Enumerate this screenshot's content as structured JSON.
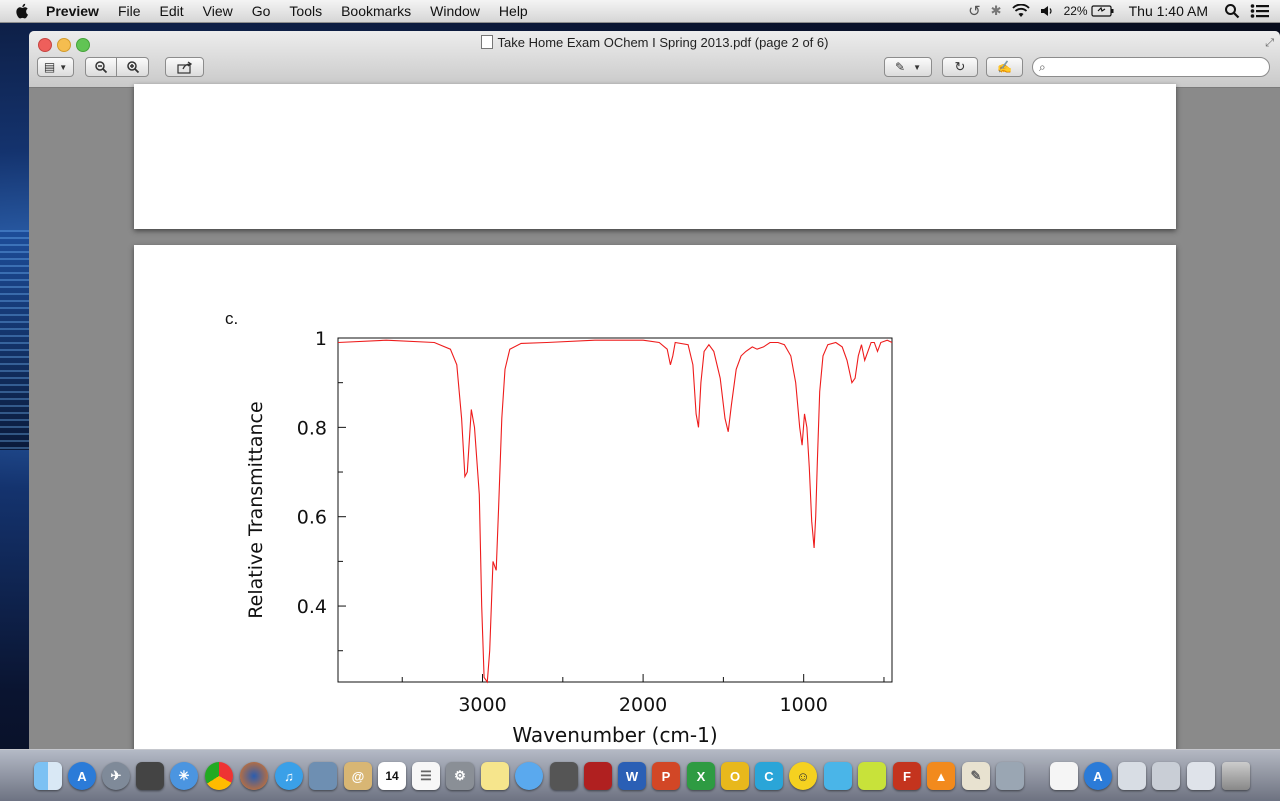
{
  "menubar": {
    "app_name": "Preview",
    "items": [
      "File",
      "Edit",
      "View",
      "Go",
      "Tools",
      "Bookmarks",
      "Window",
      "Help"
    ],
    "battery": "22%",
    "clock": "Thu 1:40 AM"
  },
  "window": {
    "title": "Take Home Exam OChem I Spring 2013.pdf (page 2 of 6)"
  },
  "document": {
    "question_label": "c."
  },
  "chart_data": {
    "type": "line",
    "xlabel": "Wavenumber (cm-1)",
    "ylabel": "Relative Transmittance",
    "xlim": [
      3900,
      450
    ],
    "ylim": [
      0.23,
      1.0
    ],
    "x_ticks": [
      3000,
      2000,
      1000
    ],
    "x_tick_labels": [
      "3000",
      "2000",
      "1000"
    ],
    "y_ticks": [
      1.0,
      0.8,
      0.6,
      0.4
    ],
    "y_tick_labels": [
      "1",
      "0.8",
      "0.6",
      "0.4"
    ],
    "series": [
      {
        "color": "#ee1c1c",
        "points": [
          [
            3900,
            0.99
          ],
          [
            3600,
            0.995
          ],
          [
            3300,
            0.99
          ],
          [
            3200,
            0.975
          ],
          [
            3160,
            0.94
          ],
          [
            3130,
            0.82
          ],
          [
            3110,
            0.69
          ],
          [
            3095,
            0.7
          ],
          [
            3070,
            0.84
          ],
          [
            3050,
            0.8
          ],
          [
            3020,
            0.65
          ],
          [
            3005,
            0.4
          ],
          [
            2990,
            0.24
          ],
          [
            2970,
            0.23
          ],
          [
            2955,
            0.3
          ],
          [
            2935,
            0.5
          ],
          [
            2915,
            0.48
          ],
          [
            2900,
            0.62
          ],
          [
            2880,
            0.82
          ],
          [
            2860,
            0.93
          ],
          [
            2830,
            0.975
          ],
          [
            2760,
            0.988
          ],
          [
            2600,
            0.99
          ],
          [
            2300,
            0.995
          ],
          [
            2000,
            0.995
          ],
          [
            1900,
            0.99
          ],
          [
            1850,
            0.975
          ],
          [
            1830,
            0.94
          ],
          [
            1815,
            0.96
          ],
          [
            1800,
            0.99
          ],
          [
            1720,
            0.985
          ],
          [
            1690,
            0.94
          ],
          [
            1670,
            0.83
          ],
          [
            1655,
            0.8
          ],
          [
            1640,
            0.9
          ],
          [
            1620,
            0.97
          ],
          [
            1590,
            0.985
          ],
          [
            1560,
            0.97
          ],
          [
            1520,
            0.91
          ],
          [
            1490,
            0.82
          ],
          [
            1470,
            0.79
          ],
          [
            1450,
            0.85
          ],
          [
            1420,
            0.93
          ],
          [
            1390,
            0.96
          ],
          [
            1360,
            0.97
          ],
          [
            1320,
            0.98
          ],
          [
            1290,
            0.975
          ],
          [
            1250,
            0.98
          ],
          [
            1210,
            0.99
          ],
          [
            1160,
            0.99
          ],
          [
            1120,
            0.985
          ],
          [
            1080,
            0.96
          ],
          [
            1050,
            0.9
          ],
          [
            1025,
            0.8
          ],
          [
            1010,
            0.76
          ],
          [
            995,
            0.83
          ],
          [
            980,
            0.8
          ],
          [
            965,
            0.71
          ],
          [
            950,
            0.59
          ],
          [
            935,
            0.53
          ],
          [
            925,
            0.6
          ],
          [
            915,
            0.72
          ],
          [
            900,
            0.88
          ],
          [
            880,
            0.96
          ],
          [
            850,
            0.985
          ],
          [
            800,
            0.99
          ],
          [
            760,
            0.98
          ],
          [
            730,
            0.95
          ],
          [
            700,
            0.9
          ],
          [
            680,
            0.91
          ],
          [
            660,
            0.96
          ],
          [
            640,
            0.985
          ],
          [
            620,
            0.95
          ],
          [
            600,
            0.97
          ],
          [
            580,
            0.99
          ],
          [
            560,
            0.99
          ],
          [
            540,
            0.97
          ],
          [
            520,
            0.99
          ],
          [
            480,
            0.995
          ],
          [
            450,
            0.99
          ]
        ]
      }
    ],
    "grid": false,
    "legend": "none"
  },
  "dock": {
    "icons": [
      "finder-icon",
      "app-store-icon",
      "launchpad-icon",
      "photo-booth-icon",
      "safari-icon",
      "chrome-icon",
      "firefox-icon",
      "itunes-icon",
      "preview-icon",
      "mail-icon",
      "calendar-icon",
      "reminders-icon",
      "system-preferences-icon",
      "stickies-icon",
      "messages-icon",
      "facetime-icon",
      "photo-icon",
      "word-icon",
      "powerpoint-icon",
      "excel-icon",
      "outlook-icon",
      "lync-icon",
      "emoji-icon",
      "chat-icon",
      "game-icon",
      "flash-icon",
      "vlc-icon",
      "textedit-icon",
      "preview-2-icon",
      "document-icon",
      "app-store-2-icon",
      "downloads-icon",
      "stacks-icon",
      "stacks-2-icon",
      "trash-icon"
    ],
    "calendar_day": "14",
    "word_letter": "W",
    "powerpoint_letter": "P",
    "excel_letter": "X",
    "outlook_letter": "O",
    "lync_letter": "C"
  },
  "colors": {
    "spectrum": "#ee1c1c",
    "close": "#ee5f5b",
    "minimize": "#f5bd4f",
    "zoom": "#61c454"
  }
}
